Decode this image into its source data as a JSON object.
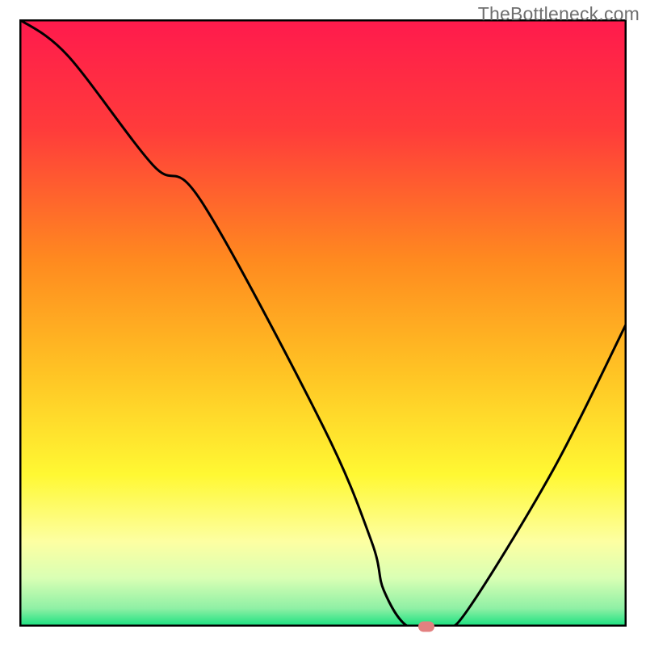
{
  "watermark": {
    "text": "TheBottleneck.com"
  },
  "colors": {
    "gradient_stops": [
      {
        "offset": 0.0,
        "color": "#ff1a4d"
      },
      {
        "offset": 0.18,
        "color": "#ff3b3b"
      },
      {
        "offset": 0.4,
        "color": "#ff8b1f"
      },
      {
        "offset": 0.58,
        "color": "#ffc324"
      },
      {
        "offset": 0.75,
        "color": "#fff833"
      },
      {
        "offset": 0.86,
        "color": "#fdffa2"
      },
      {
        "offset": 0.92,
        "color": "#d9ffb4"
      },
      {
        "offset": 0.97,
        "color": "#8ff0a5"
      },
      {
        "offset": 1.0,
        "color": "#15e07e"
      }
    ],
    "frame": "#000000",
    "curve": "#000000",
    "marker": "#e38080"
  },
  "chart_data": {
    "type": "line",
    "title": "",
    "xlabel": "",
    "ylabel": "",
    "xlim": [
      0,
      100
    ],
    "ylim": [
      0,
      100
    ],
    "grid": false,
    "series": [
      {
        "name": "bottleneck-curve",
        "x": [
          0,
          8,
          22,
          30,
          50,
          58,
          60,
          64,
          70,
          74,
          88,
          100
        ],
        "values": [
          100,
          94,
          76,
          70,
          33,
          14,
          6,
          0,
          0,
          3,
          26,
          50
        ]
      }
    ],
    "markers": [
      {
        "name": "optimum-point",
        "x": 67,
        "y": 0
      }
    ],
    "annotations": []
  }
}
